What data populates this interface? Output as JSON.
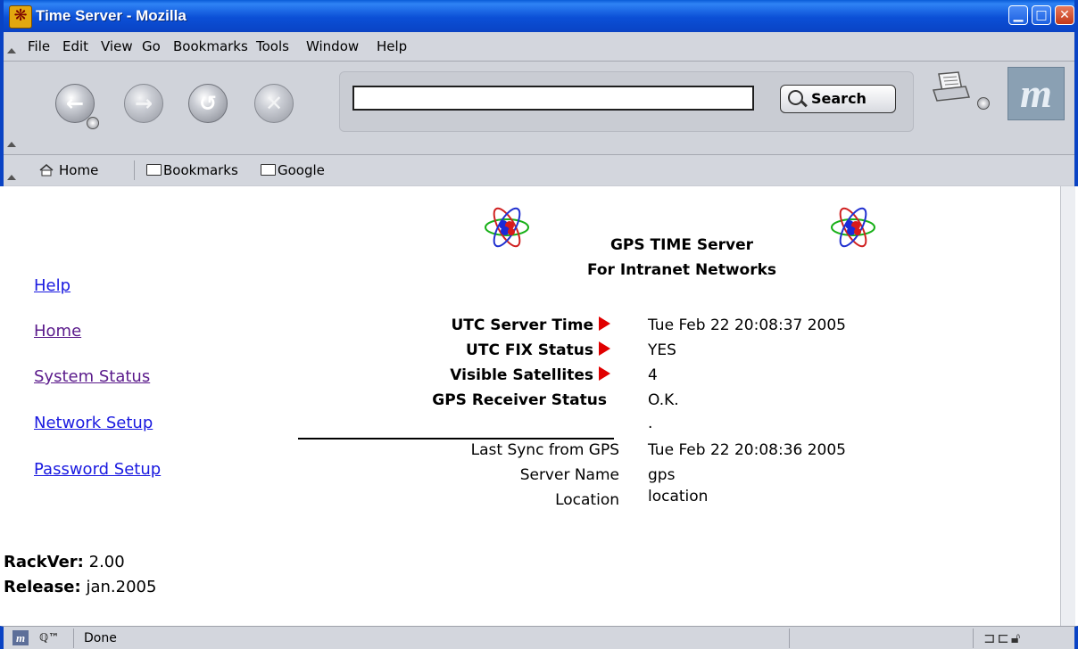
{
  "window": {
    "title": "Time Server - Mozilla",
    "minimize": "▁",
    "maximize": "□",
    "close": "✕"
  },
  "menubar": {
    "items": [
      "File",
      "Edit",
      "View",
      "Go",
      "Bookmarks",
      "Tools",
      "Window",
      "Help"
    ]
  },
  "navigation": {
    "back_icon": "back-arrow",
    "forward_icon": "forward-arrow",
    "reload_icon": "reload",
    "stop_icon": "stop",
    "url_value": "",
    "search_label": "Search"
  },
  "personal_toolbar": {
    "home": "Home",
    "bookmarks": "Bookmarks",
    "google": "Google"
  },
  "sidebar": {
    "links": [
      "Help",
      "Home",
      "System Status",
      "Network Setup",
      "Password Setup"
    ],
    "rackver_label": "RackVer:",
    "rackver_value": "2.00",
    "release_label": "Release:",
    "release_value": "jan.2005"
  },
  "header": {
    "line1": "GPS TIME Server",
    "line2": "For Intranet Networks"
  },
  "status": {
    "utc_time_label": "UTC Server Time",
    "utc_time_value": "Tue Feb 22 20:08:37 2005",
    "fix_label": "UTC FIX Status",
    "fix_value": "YES",
    "sat_label": "Visible Satellites",
    "sat_value": "4",
    "receiver_label": "GPS Receiver Status",
    "receiver_value": "O.K.",
    "dot": "."
  },
  "info": {
    "sync_label": "Last Sync from GPS",
    "sync_value": "Tue Feb 22 20:08:36 2005",
    "name_label": "Server Name",
    "name_value": "gps",
    "location_label": "Location",
    "location_value": "location"
  },
  "statusbar": {
    "text": "Done"
  },
  "colors": {
    "titlebar": "#0a43c4",
    "link": "#1a1ae0",
    "visited_link": "#5a1a8b",
    "arrow": "#e00000"
  }
}
